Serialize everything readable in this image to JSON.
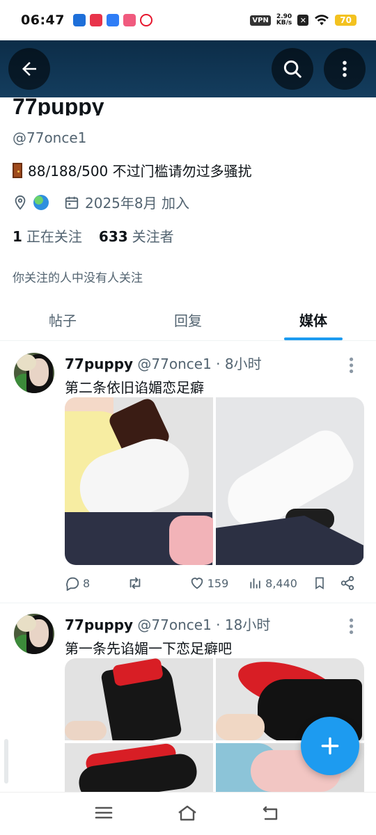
{
  "status_bar": {
    "time": "06:47",
    "vpn": "VPN",
    "speed_value": "2.90",
    "speed_unit": "KB/s",
    "battery": "70",
    "notification_icons": [
      "app-icon-1",
      "app-icon-2",
      "app-icon-3",
      "app-icon-4",
      "weibo-icon"
    ]
  },
  "profile": {
    "display_name": "77puppy",
    "handle": "@77once1",
    "bio": "88/188/500 不过门槛请勿过多骚扰",
    "joined": "2025年8月 加入",
    "following_count": "1",
    "following_label": "正在关注",
    "followers_count": "633",
    "followers_label": "关注者",
    "followed_by_note": "你关注的人中没有人关注"
  },
  "tabs": [
    {
      "label": "帖子",
      "active": false
    },
    {
      "label": "回复",
      "active": false
    },
    {
      "label": "媒体",
      "active": true
    }
  ],
  "tweets": [
    {
      "name": "77puppy",
      "handle_time": "@77once1 · 8小时",
      "text": "第二条依旧谄媚恋足癖",
      "replies": "8",
      "retweets": "",
      "likes": "159",
      "views": "8,440"
    },
    {
      "name": "77puppy",
      "handle_time": "@77once1 · 18小时",
      "text": "第一条先谄媚一下恋足癖吧"
    }
  ],
  "colors": {
    "accent": "#1d9bf0",
    "header_band": "#0c2d48",
    "secondary_text": "#536471"
  }
}
